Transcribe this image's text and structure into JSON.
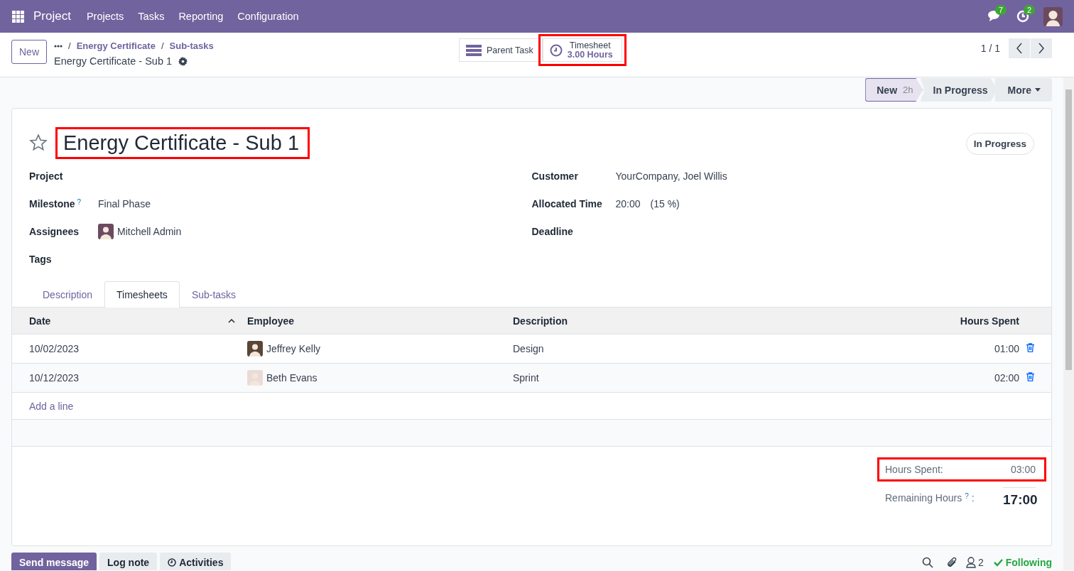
{
  "navbar": {
    "app": "Project",
    "menu": [
      "Projects",
      "Tasks",
      "Reporting",
      "Configuration"
    ],
    "messages_count": "7",
    "activities_count": "2"
  },
  "control_panel": {
    "new_button": "New",
    "breadcrumbs": [
      "Energy Certificate",
      "Sub-tasks"
    ],
    "current": "Energy Certificate - Sub 1",
    "separator": "/",
    "pager": "1 / 1"
  },
  "smart_buttons": [
    {
      "kind": "parent",
      "label": "Parent Task",
      "highlighted": false
    },
    {
      "kind": "timesheet",
      "label": "Timesheet",
      "value": "3.00 Hours",
      "highlighted": true
    }
  ],
  "statusbar": {
    "stages": [
      {
        "label": "New",
        "count": "2h",
        "selected": true
      },
      {
        "label": "In Progress",
        "selected": false
      }
    ],
    "more": "More"
  },
  "form": {
    "title": "Energy Certificate - Sub 1",
    "title_highlighted": true,
    "starred": false,
    "state": "In Progress",
    "left_fields": [
      {
        "label": "Project"
      },
      {
        "label": "Milestone",
        "help": "?",
        "value": "Final Phase"
      },
      {
        "label": "Assignees",
        "value": "Mitchell Admin",
        "kind": "avatar"
      },
      {
        "label": "Tags"
      }
    ],
    "right_fields": [
      {
        "label": "Customer",
        "value": "YourCompany, Joel Willis"
      },
      {
        "label": "Allocated Time",
        "value": "20:00",
        "extra": "(15 %)"
      },
      {
        "label": "Deadline"
      }
    ],
    "tabs": [
      {
        "label": "Description",
        "selected": false
      },
      {
        "label": "Timesheets",
        "selected": true
      },
      {
        "label": "Sub-tasks",
        "selected": false
      }
    ],
    "table": {
      "columns": [
        "Date",
        "Employee",
        "Description",
        "Hours Spent"
      ],
      "rows": [
        {
          "date": "10/02/2023",
          "employee": "Jeffrey Kelly",
          "description": "Design",
          "hours": "01:00"
        },
        {
          "date": "10/12/2023",
          "employee": "Beth Evans",
          "description": "Sprint",
          "hours": "02:00"
        }
      ],
      "add_line": "Add a line"
    },
    "totals": {
      "hours_spent_label": "Hours Spent:",
      "hours_spent": "03:00",
      "hours_spent_highlighted": true,
      "remaining_label": "Remaining Hours",
      "remaining_help": "?",
      "remaining_suffix": ":",
      "remaining": "17:00"
    }
  },
  "chatter": {
    "buttons": [
      {
        "kind": "primary",
        "label": "Send message"
      },
      {
        "kind": "secondary",
        "label": "Log note"
      },
      {
        "kind": "activities",
        "label": "Activities"
      }
    ],
    "followers": "2",
    "following": "Following"
  }
}
